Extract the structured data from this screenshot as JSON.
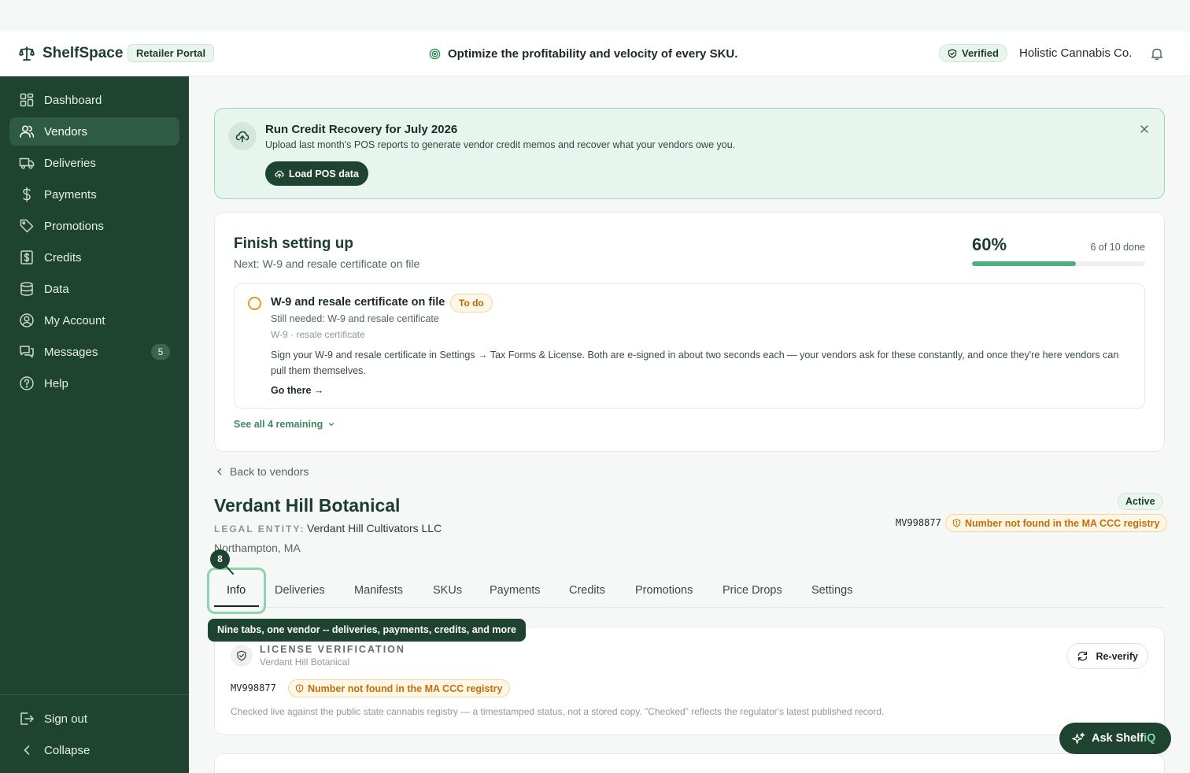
{
  "header": {
    "app_name": "ShelfSpace",
    "portal_badge": "Retailer Portal",
    "tagline": "Optimize the profitability and velocity of every SKU.",
    "verified_label": "Verified",
    "company": "Holistic Cannabis Co."
  },
  "sidebar": {
    "items": [
      {
        "label": "Dashboard",
        "icon": "grid-icon"
      },
      {
        "label": "Vendors",
        "icon": "users-icon",
        "active": true
      },
      {
        "label": "Deliveries",
        "icon": "truck-icon"
      },
      {
        "label": "Payments",
        "icon": "dollar-icon"
      },
      {
        "label": "Promotions",
        "icon": "tag-icon"
      },
      {
        "label": "Credits",
        "icon": "receipt-icon"
      },
      {
        "label": "Data",
        "icon": "database-icon"
      },
      {
        "label": "My Account",
        "icon": "user-circle-icon"
      },
      {
        "label": "Messages",
        "icon": "chat-icon",
        "count": "5"
      },
      {
        "label": "Help",
        "icon": "help-icon"
      }
    ],
    "sign_out": "Sign out",
    "collapse": "Collapse"
  },
  "banner": {
    "title": "Run Credit Recovery for July 2026",
    "description": "Upload last month's POS reports to generate vendor credit memos and recover what your vendors owe you.",
    "button": "Load POS data"
  },
  "setup": {
    "title": "Finish setting up",
    "next": "Next: W-9 and resale certificate on file",
    "percent": "60%",
    "progress_fraction": 0.6,
    "done": "6 of 10 done",
    "task": {
      "title": "W-9 and resale certificate on file",
      "status": "To do",
      "needed": "Still needed: W-9 and resale certificate",
      "docs": "W-9 · resale certificate",
      "body": "Sign your W-9 and resale certificate in Settings → Tax Forms & License. Both are e-signed in about two seconds each — your vendors ask for these constantly, and once they're here vendors can pull them themselves.",
      "link": "Go there →"
    },
    "see_all": "See all 4 remaining"
  },
  "vendor": {
    "back": "Back to vendors",
    "name": "Verdant Hill Botanical",
    "legal_label": "LEGAL ENTITY:",
    "legal_value": "Verdant Hill Cultivators LLC",
    "location": "Northampton, MA",
    "status": "Active",
    "license_number": "MV998877",
    "license_warning": "Number not found in the MA CCC registry"
  },
  "tour": {
    "step": "8",
    "tooltip": "Nine tabs, one vendor -- deliveries, payments, credits, and more"
  },
  "tabs": [
    "Info",
    "Deliveries",
    "Manifests",
    "SKUs",
    "Payments",
    "Credits",
    "Promotions",
    "Price Drops",
    "Settings"
  ],
  "license_card": {
    "title": "LICENSE VERIFICATION",
    "subtitle": "Verdant Hill Botanical",
    "reverify": "Re-verify",
    "number": "MV998877",
    "warning": "Number not found in the MA CCC registry",
    "note": "Checked live against the public state cannabis registry — a timestamped status, not a stored copy. \"Checked\" reflects the regulator's latest published record."
  },
  "assistant": {
    "label_main": "Ask Shelf",
    "label_accent": "iQ"
  }
}
